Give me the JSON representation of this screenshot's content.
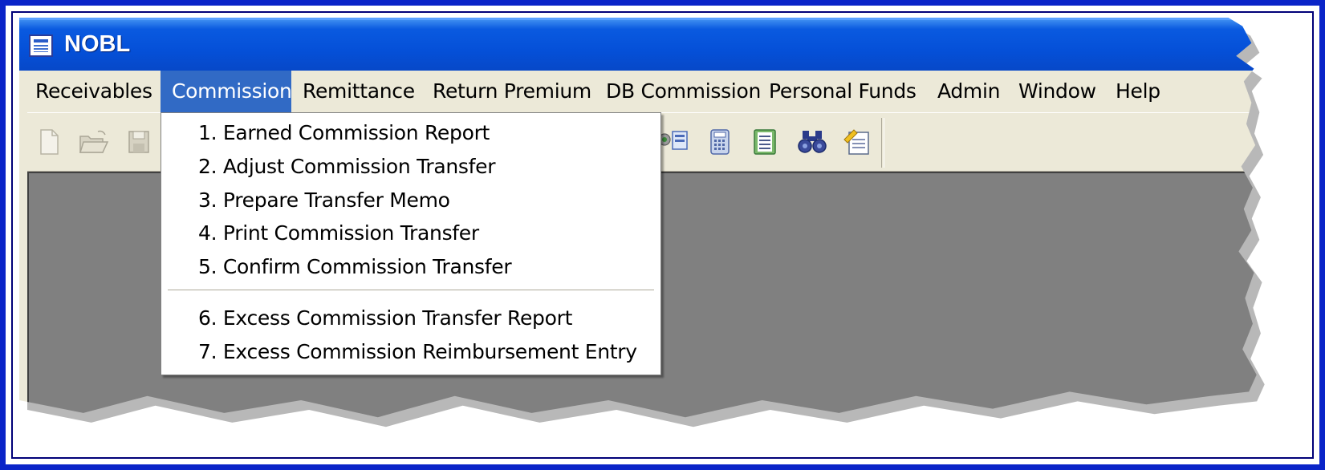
{
  "window": {
    "title": "NOBL",
    "icon": "app-window-icon"
  },
  "menubar": {
    "items": [
      {
        "label": "Receivables"
      },
      {
        "label": "Commission",
        "active": true
      },
      {
        "label": "Remittance"
      },
      {
        "label": "Return Premium"
      },
      {
        "label": "DB Commission"
      },
      {
        "label": "Personal Funds"
      },
      {
        "label": "Admin"
      },
      {
        "label": "Window"
      },
      {
        "label": "Help"
      }
    ]
  },
  "toolbar": {
    "icons": [
      "new-document-icon",
      "open-folder-icon",
      "save-icon",
      "users-icon",
      "calculator-icon",
      "list-document-icon",
      "binoculars-find-icon",
      "edit-note-icon"
    ]
  },
  "commission_menu": {
    "group1": [
      "1. Earned Commission Report",
      "2. Adjust Commission Transfer",
      "3. Prepare Transfer Memo",
      "4. Print Commission Transfer",
      "5. Confirm Commission Transfer"
    ],
    "group2": [
      "6. Excess Commission Transfer Report",
      "7. Excess Commission Reimbursement Entry"
    ]
  },
  "colors": {
    "frame_border": "#0a24c8",
    "titlebar": "#0550d8",
    "menu_highlight": "#316ac5",
    "menubar_bg": "#ece9d8",
    "client_bg": "#808080"
  }
}
